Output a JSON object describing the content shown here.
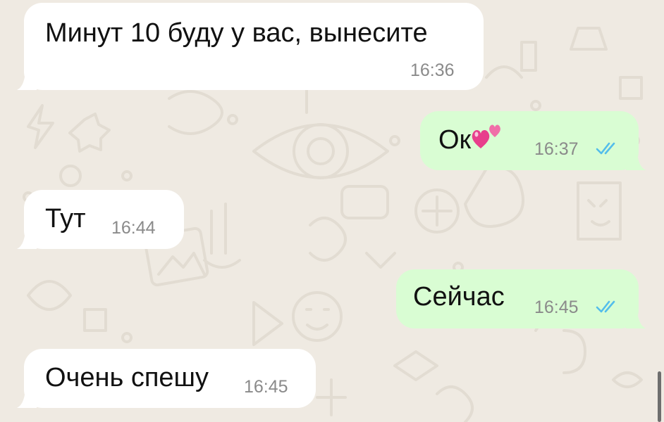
{
  "chat": {
    "messages": [
      {
        "direction": "incoming",
        "text": "Минут 10 буду у вас, вынесите",
        "time": "16:36"
      },
      {
        "direction": "outgoing",
        "text": "Ок",
        "emoji": "two-hearts",
        "time": "16:37",
        "status": "read"
      },
      {
        "direction": "incoming",
        "text": "Тут",
        "time": "16:44"
      },
      {
        "direction": "outgoing",
        "text": "Сейчас",
        "time": "16:45",
        "status": "read"
      },
      {
        "direction": "incoming",
        "text": "Очень спешу",
        "time": "16:45"
      }
    ]
  },
  "colors": {
    "background": "#efeae2",
    "incoming_bubble": "#ffffff",
    "outgoing_bubble": "#d9fdd3",
    "read_ticks": "#53bdeb",
    "time_text": "#8a8a8a"
  },
  "icons": [
    "read-receipt-icon",
    "two-hearts-emoji",
    "scrollbar-thumb"
  ]
}
